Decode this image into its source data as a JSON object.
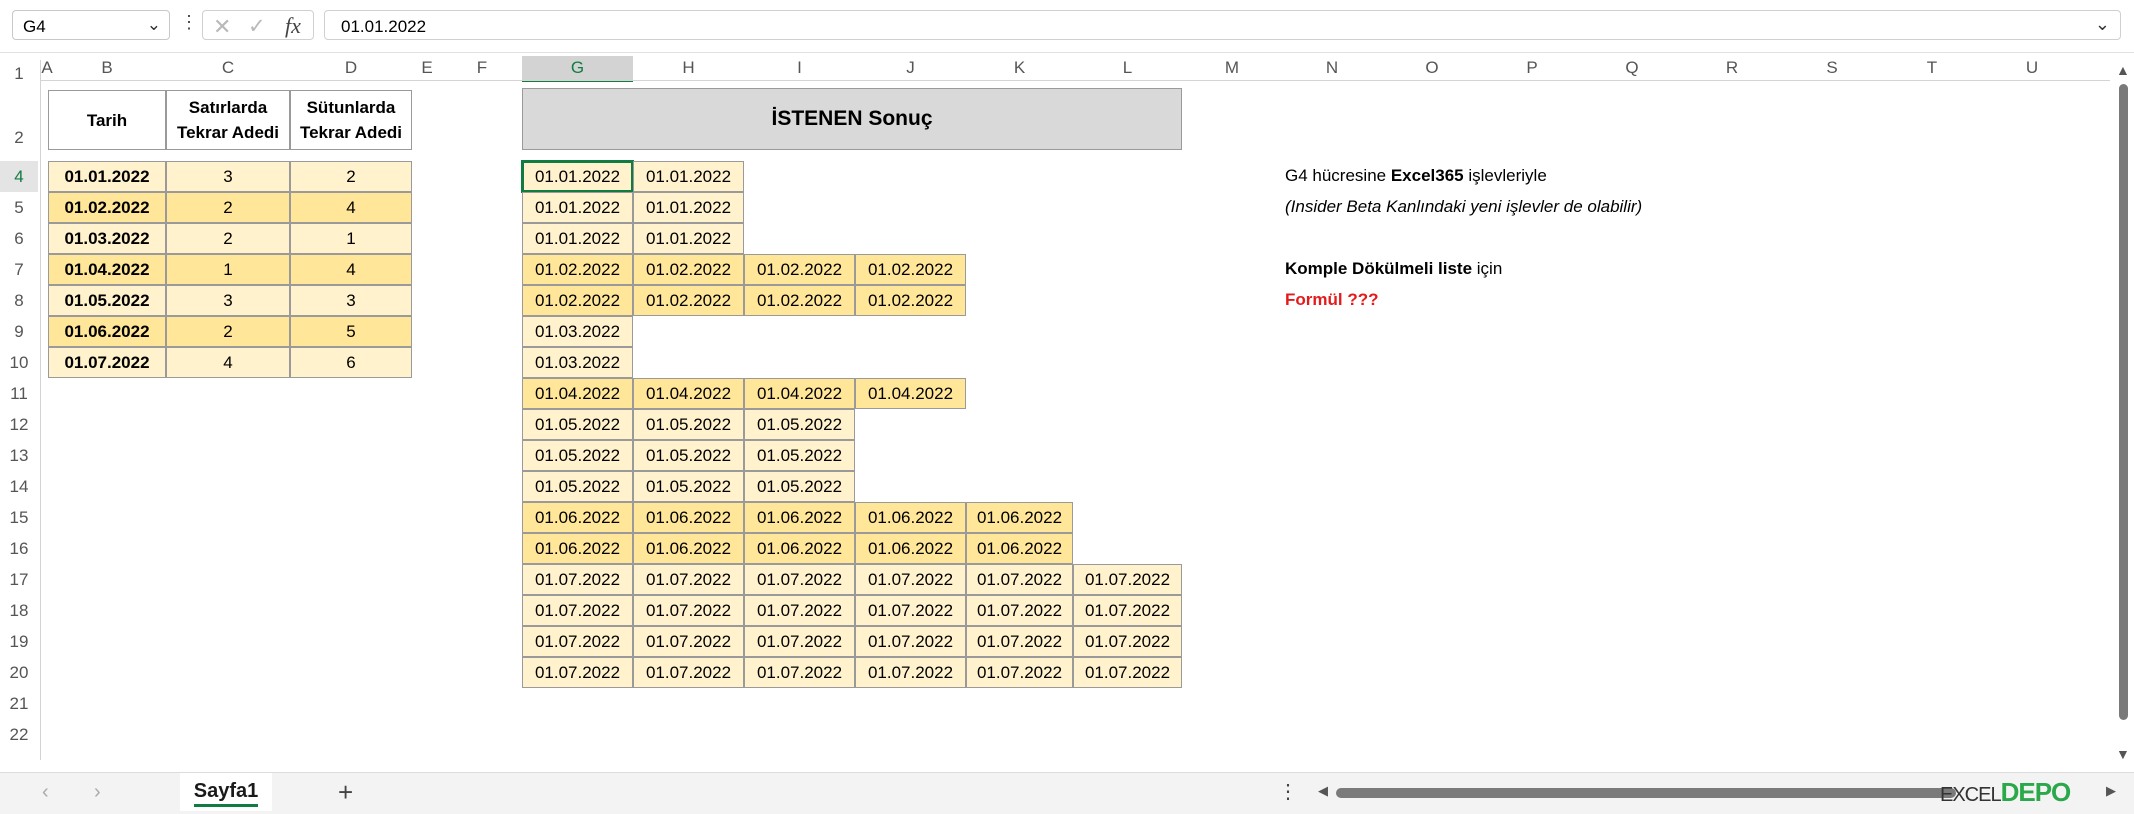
{
  "namebox": "G4",
  "formula": "01.01.2022",
  "columns": [
    "A",
    "B",
    "C",
    "D",
    "E",
    "F",
    "G",
    "H",
    "I",
    "J",
    "K",
    "L",
    "M",
    "N",
    "O",
    "P",
    "Q",
    "R",
    "S",
    "T",
    "U"
  ],
  "rows": [
    "1",
    "2",
    "4",
    "5",
    "6",
    "7",
    "8",
    "9",
    "10",
    "11",
    "12",
    "13",
    "14",
    "15",
    "16",
    "17",
    "18",
    "19",
    "20",
    "21",
    "22"
  ],
  "table": {
    "headers": [
      "Tarih",
      "Satırlarda Tekrar Adedi",
      "Sütunlarda Tekrar Adedi"
    ],
    "rows": [
      {
        "date": "01.01.2022",
        "r": "3",
        "c": "2"
      },
      {
        "date": "01.02.2022",
        "r": "2",
        "c": "4"
      },
      {
        "date": "01.03.2022",
        "r": "2",
        "c": "1"
      },
      {
        "date": "01.04.2022",
        "r": "1",
        "c": "4"
      },
      {
        "date": "01.05.2022",
        "r": "3",
        "c": "3"
      },
      {
        "date": "01.06.2022",
        "r": "2",
        "c": "5"
      },
      {
        "date": "01.07.2022",
        "r": "4",
        "c": "6"
      }
    ]
  },
  "result_title": "İSTENEN Sonuç",
  "result_rows": [
    [
      "01.01.2022",
      "01.01.2022"
    ],
    [
      "01.01.2022",
      "01.01.2022"
    ],
    [
      "01.01.2022",
      "01.01.2022"
    ],
    [
      "01.02.2022",
      "01.02.2022",
      "01.02.2022",
      "01.02.2022"
    ],
    [
      "01.02.2022",
      "01.02.2022",
      "01.02.2022",
      "01.02.2022"
    ],
    [
      "01.03.2022"
    ],
    [
      "01.03.2022"
    ],
    [
      "01.04.2022",
      "01.04.2022",
      "01.04.2022",
      "01.04.2022"
    ],
    [
      "01.05.2022",
      "01.05.2022",
      "01.05.2022"
    ],
    [
      "01.05.2022",
      "01.05.2022",
      "01.05.2022"
    ],
    [
      "01.05.2022",
      "01.05.2022",
      "01.05.2022"
    ],
    [
      "01.06.2022",
      "01.06.2022",
      "01.06.2022",
      "01.06.2022",
      "01.06.2022"
    ],
    [
      "01.06.2022",
      "01.06.2022",
      "01.06.2022",
      "01.06.2022",
      "01.06.2022"
    ],
    [
      "01.07.2022",
      "01.07.2022",
      "01.07.2022",
      "01.07.2022",
      "01.07.2022",
      "01.07.2022"
    ],
    [
      "01.07.2022",
      "01.07.2022",
      "01.07.2022",
      "01.07.2022",
      "01.07.2022",
      "01.07.2022"
    ],
    [
      "01.07.2022",
      "01.07.2022",
      "01.07.2022",
      "01.07.2022",
      "01.07.2022",
      "01.07.2022"
    ],
    [
      "01.07.2022",
      "01.07.2022",
      "01.07.2022",
      "01.07.2022",
      "01.07.2022",
      "01.07.2022"
    ]
  ],
  "notes": {
    "line1_a": "G4 hücresine ",
    "line1_b": "Excel365",
    "line1_c": " işlevleriyle",
    "line2": "(Insider Beta Kanlındaki yeni işlevler de olabilir)",
    "line3_a": "Komple Dökülmeli liste",
    "line3_b": " için",
    "line4": "Formül ???"
  },
  "sheet_tab": "Sayfa1",
  "logo": {
    "a": "EXCEL",
    "b": "DEPO"
  },
  "colors": {
    "light": "#fff2cc",
    "dark": "#ffe699",
    "accent": "#107c41",
    "red": "#e41b1b"
  }
}
